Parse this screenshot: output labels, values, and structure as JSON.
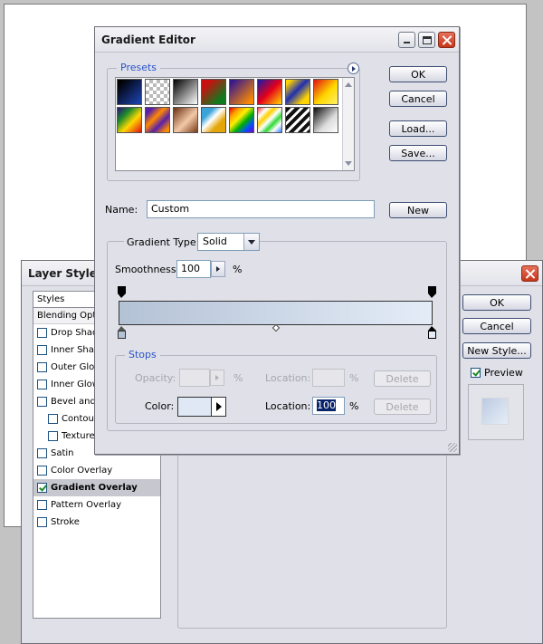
{
  "layer_style": {
    "title": "Layer Style",
    "styles_header": "Styles",
    "blending_options": "Blending Options",
    "items": [
      {
        "label": "Drop Shadow",
        "checked": false,
        "indent": false,
        "selected": false
      },
      {
        "label": "Inner Shadow",
        "checked": false,
        "indent": false,
        "selected": false
      },
      {
        "label": "Outer Glow",
        "checked": false,
        "indent": false,
        "selected": false
      },
      {
        "label": "Inner Glow",
        "checked": false,
        "indent": false,
        "selected": false
      },
      {
        "label": "Bevel and Emboss",
        "checked": false,
        "indent": false,
        "selected": false
      },
      {
        "label": "Contour",
        "checked": false,
        "indent": true,
        "selected": false
      },
      {
        "label": "Texture",
        "checked": false,
        "indent": true,
        "selected": false
      },
      {
        "label": "Satin",
        "checked": false,
        "indent": false,
        "selected": false
      },
      {
        "label": "Color Overlay",
        "checked": false,
        "indent": false,
        "selected": false
      },
      {
        "label": "Gradient Overlay",
        "checked": true,
        "indent": false,
        "selected": true
      },
      {
        "label": "Pattern Overlay",
        "checked": false,
        "indent": false,
        "selected": false
      },
      {
        "label": "Stroke",
        "checked": false,
        "indent": false,
        "selected": false
      }
    ],
    "ok_label": "OK",
    "cancel_label": "Cancel",
    "new_style_label": "New Style...",
    "preview_label": "Preview",
    "preview_checked": true
  },
  "gradient_editor": {
    "title": "Gradient Editor",
    "presets_label": "Presets",
    "presets": [
      "linear-gradient(135deg,#000 10%,#1b3fa6 90%)",
      "repeating-conic-gradient(#bbb 0 25%,#fff 0 50%) 0 0/8px 8px",
      "linear-gradient(135deg,#000,#fff)",
      "linear-gradient(135deg,#c81010 20%,#0f7a1e 80%)",
      "linear-gradient(135deg,#3a1a8a 10%,#ff8c00 90%)",
      "linear-gradient(135deg,#1a1aa8,#e4001a 50%,#ffd800)",
      "linear-gradient(135deg,#ffd400 10%,#1f2fb0 45%,#ffd400 80%)",
      "linear-gradient(135deg,#e01010,#ffd800 55%,#fff16a)",
      "linear-gradient(135deg,#2a0f7a,#1d8a2c 30%,#ffd800 60%,#e01010)",
      "linear-gradient(135deg,#5a1fa8 15%,#ff8a00 40%,#5a1fa8 65%,#ff8a00 90%)",
      "linear-gradient(135deg,#6b2f12,#f3c9a8 55%,#7a3a18)",
      "linear-gradient(135deg,#3aa3d8 25%,#ffffff 45%,#e5a60a 70%)",
      "linear-gradient(135deg,#e00000,#ff9f00,#ffef00,#00b000,#0050ff,#7a00c8)",
      "linear-gradient(135deg,#ff3a3a,#fff 20%,#ffd000 35%,#fff 50%,#32d838 65%,#fff 80%,#2f7bff)",
      "repeating-linear-gradient(135deg,#111 0 4px,#fff 4px 7px)",
      "linear-gradient(135deg,#0c0c0c,#dcdcdc 60%,#ffffff)"
    ],
    "ok_label": "OK",
    "cancel_label": "Cancel",
    "load_label": "Load...",
    "save_label": "Save...",
    "name_label": "Name:",
    "name_value": "Custom",
    "new_label": "New",
    "gradient_type_label": "Gradient Type:",
    "gradient_type_value": "Solid",
    "smoothness_label": "Smoothness:",
    "smoothness_value": "100",
    "percent": "%",
    "gradient_start_color": "#b4c2d6",
    "gradient_end_color": "#e4ecf7",
    "stops_label": "Stops",
    "opacity_label": "Opacity:",
    "opacity_value": "",
    "location_label": "Location:",
    "opacity_location_value": "",
    "delete_label": "Delete",
    "color_label": "Color:",
    "color_value": "#dfe8f4",
    "color_location_value": "100"
  }
}
